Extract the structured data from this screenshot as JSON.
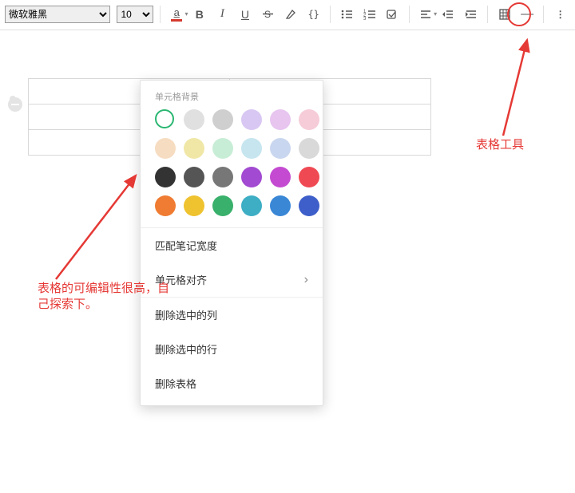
{
  "toolbar": {
    "font": "微软雅黑",
    "size": "10",
    "buttons": {
      "text_color": "文字颜色",
      "bold": "B",
      "italic": "I",
      "underline": "U",
      "strike": "S",
      "highlight": "高亮",
      "code": "{}",
      "bullet": "项目符号",
      "numbered": "编号",
      "checkbox": "任务",
      "align": "对齐",
      "outdent": "减少缩进",
      "indent": "增加缩进",
      "table": "表格",
      "hr": "—",
      "more": "⋮"
    }
  },
  "popup": {
    "section_label": "单元格背景",
    "colors_row1": [
      "#ffffff",
      "#e0e0e0",
      "#cfcfcf",
      "#d8c7f2",
      "#e7c5ef",
      "#f6ccd8"
    ],
    "colors_row2": [
      "#f6dcc1",
      "#f0e7a7",
      "#c7edd6",
      "#c6e5ef",
      "#c9d6ef",
      "#d9d9d9"
    ],
    "colors_row3": [
      "#333333",
      "#555555",
      "#777777",
      "#a24ad1",
      "#c44bd1",
      "#ef4a53"
    ],
    "colors_row4": [
      "#ef7c32",
      "#efc22f",
      "#39b06b",
      "#3daec4",
      "#3a87d6",
      "#3e5fc9"
    ],
    "match_width": "匹配笔记宽度",
    "cell_align": "单元格对齐",
    "del_cols": "删除选中的列",
    "del_rows": "删除选中的行",
    "del_table": "删除表格"
  },
  "annotations": {
    "left": "表格的可编辑性很高，自己探索下。",
    "right": "表格工具"
  }
}
